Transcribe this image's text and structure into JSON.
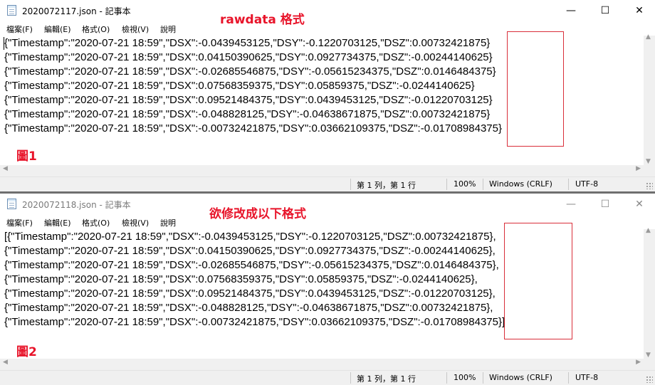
{
  "window1": {
    "title": "2020072117.json - 記事本",
    "annotation": "rawdata 格式",
    "figure_label": "圖1",
    "lines": [
      "{\"Timestamp\":\"2020-07-21 18:59\",\"DSX\":-0.0439453125,\"DSY\":-0.1220703125,\"DSZ\":0.00732421875}",
      "{\"Timestamp\":\"2020-07-21 18:59\",\"DSX\":0.04150390625,\"DSY\":0.0927734375,\"DSZ\":-0.00244140625}",
      "{\"Timestamp\":\"2020-07-21 18:59\",\"DSX\":-0.02685546875,\"DSY\":-0.05615234375,\"DSZ\":0.0146484375}",
      "{\"Timestamp\":\"2020-07-21 18:59\",\"DSX\":0.07568359375,\"DSY\":0.05859375,\"DSZ\":-0.0244140625}",
      "{\"Timestamp\":\"2020-07-21 18:59\",\"DSX\":0.09521484375,\"DSY\":0.0439453125,\"DSZ\":-0.01220703125}",
      "{\"Timestamp\":\"2020-07-21 18:59\",\"DSX\":-0.048828125,\"DSY\":-0.04638671875,\"DSZ\":0.00732421875}",
      "{\"Timestamp\":\"2020-07-21 18:59\",\"DSX\":-0.00732421875,\"DSY\":0.03662109375,\"DSZ\":-0.01708984375}"
    ]
  },
  "window2": {
    "title": "2020072118.json - 記事本",
    "annotation": "欲修改成以下格式",
    "figure_label": "圖2",
    "lines": [
      "[{\"Timestamp\":\"2020-07-21 18:59\",\"DSX\":-0.0439453125,\"DSY\":-0.1220703125,\"DSZ\":0.00732421875},",
      "{\"Timestamp\":\"2020-07-21 18:59\",\"DSX\":0.04150390625,\"DSY\":0.0927734375,\"DSZ\":-0.00244140625},",
      "{\"Timestamp\":\"2020-07-21 18:59\",\"DSX\":-0.02685546875,\"DSY\":-0.05615234375,\"DSZ\":0.0146484375},",
      "{\"Timestamp\":\"2020-07-21 18:59\",\"DSX\":0.07568359375,\"DSY\":0.05859375,\"DSZ\":-0.0244140625},",
      "{\"Timestamp\":\"2020-07-21 18:59\",\"DSX\":0.09521484375,\"DSY\":0.0439453125,\"DSZ\":-0.01220703125},",
      "{\"Timestamp\":\"2020-07-21 18:59\",\"DSX\":-0.048828125,\"DSY\":-0.04638671875,\"DSZ\":0.00732421875},",
      "{\"Timestamp\":\"2020-07-21 18:59\",\"DSX\":-0.00732421875,\"DSY\":0.03662109375,\"DSZ\":-0.01708984375}]"
    ]
  },
  "menu": [
    "檔案(F)",
    "編輯(E)",
    "格式(O)",
    "檢視(V)",
    "說明"
  ],
  "status": {
    "position": "第 1 列，第 1 行",
    "zoom": "100%",
    "line_ending": "Windows (CRLF)",
    "encoding": "UTF-8"
  },
  "window_controls": {
    "minimize": "—",
    "maximize": "☐",
    "close": "✕"
  },
  "icons": [
    "notepad-icon",
    "minimize-icon",
    "maximize-icon",
    "close-icon",
    "scroll-up-icon",
    "scroll-down-icon",
    "scroll-left-icon",
    "scroll-right-icon",
    "resize-grip-icon"
  ],
  "colors": {
    "annotation": "#e8142a",
    "highlight_box": "#d92f3a",
    "chrome": "#f0f0f0"
  }
}
